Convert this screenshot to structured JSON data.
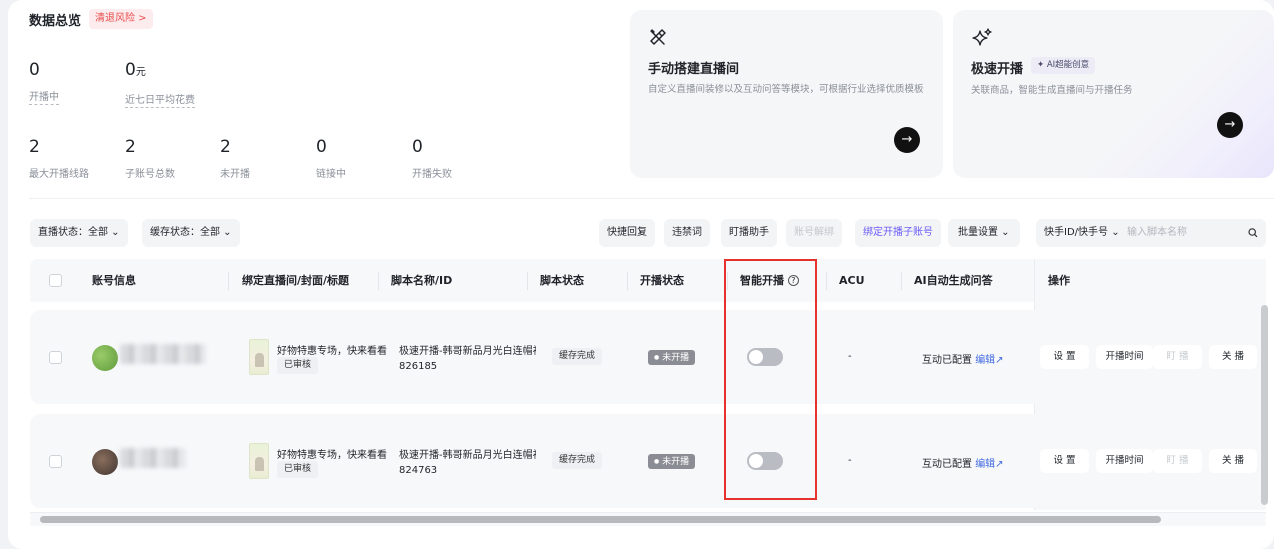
{
  "overview": {
    "title": "数据总览",
    "risk_label": "清退风险 >",
    "stats_top": [
      {
        "value": "0",
        "unit": "",
        "label": "开播中"
      },
      {
        "value": "0",
        "unit": "元",
        "label": "近七日平均花费"
      }
    ],
    "stats_bottom": [
      {
        "value": "2",
        "label": "最大开播线路"
      },
      {
        "value": "2",
        "label": "子账号总数"
      },
      {
        "value": "2",
        "label": "未开播"
      },
      {
        "value": "0",
        "label": "链接中"
      },
      {
        "value": "0",
        "label": "开播失败"
      }
    ]
  },
  "cards": {
    "manual": {
      "title": "手动搭建直播间",
      "desc": "自定义直播间装修以及互动问答等模块，可根据行业选择优质模板",
      "icon": "tools-icon"
    },
    "quick": {
      "title": "极速开播",
      "badge": "✦ AI超能创意",
      "desc": "关联商品，智能生成直播间与开播任务",
      "icon": "sparkle-icon"
    }
  },
  "filters": {
    "live_status": "直播状态：全部 ⌄",
    "cache_status": "缓存状态：全部 ⌄",
    "quick_reply": "快捷回复",
    "banned_words": "违禁词",
    "assistant": "盯播助手",
    "unbind": "账号解绑",
    "bind": "绑定开播子账号",
    "batch": "批量设置 ⌄",
    "search_select": "快手ID/快手号 ⌄",
    "search_placeholder": "输入脚本名称"
  },
  "table": {
    "headers": [
      "账号信息",
      "绑定直播间/封面/标题",
      "脚本名称/ID",
      "脚本状态",
      "开播状态",
      "智能开播",
      "ACU",
      "AI自动生成问答",
      "操作"
    ],
    "rows": [
      {
        "room_title": "好物特惠专场，快来看看",
        "audit": "已审核",
        "script_name": "极速开播-韩哥新品月光白连帽衫",
        "script_id": "826185",
        "script_status": "缓存完成",
        "live_status": "未开播",
        "acu": "-",
        "qa_status": "互动已配置",
        "qa_edit": "编辑↗"
      },
      {
        "room_title": "好物特惠专场，快来看看",
        "audit": "已审核",
        "script_name": "极速开播-韩哥新品月光白连帽衫",
        "script_id": "824763",
        "script_status": "缓存完成",
        "live_status": "未开播",
        "acu": "-",
        "qa_status": "互动已配置",
        "qa_edit": "编辑↗"
      }
    ],
    "actions": [
      "设 置",
      "开播时间",
      "盯 播",
      "关 播"
    ]
  }
}
